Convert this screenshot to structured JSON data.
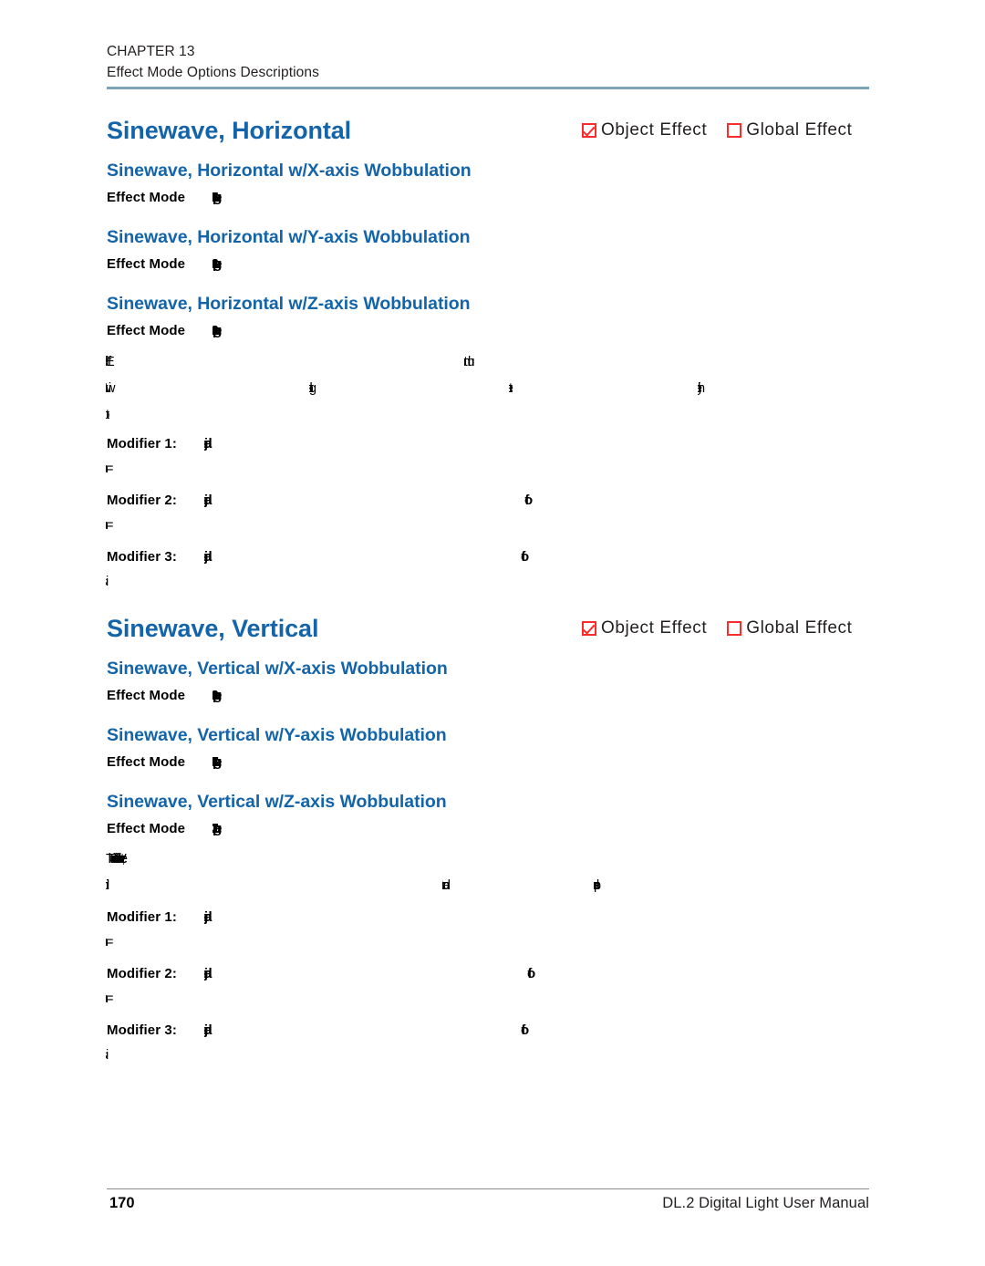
{
  "page": {
    "number": "170",
    "manual_title": "DL.2 Digital Light User Manual"
  },
  "header": {
    "chapter": "CHAPTER 13",
    "subtitle": "Effect Mode Options Descriptions",
    "rule_color": "#7ba4bb"
  },
  "scope_legend": {
    "object_effect_label": "Object  Effect",
    "global_effect_label": "Global  Effect",
    "checkbox_color": "#ff2a2a",
    "object_checked": true,
    "global_checked": false
  },
  "theme": {
    "heading_blue": "#1464aa",
    "text_black": "#231f20"
  },
  "sections": [
    {
      "title": "Sinewave, Horizontal",
      "scope": {
        "object_effect_label": "Object  Effect",
        "global_effect_label": "Global  Effect"
      },
      "subsections": [
        {
          "heading": "Sinewave, Horizontal w/X-axis Wobbulation",
          "field_label": "Effect Mode",
          "field_value": "page 165"
        },
        {
          "heading": "Sinewave, Horizontal w/Y-axis Wobbulation",
          "field_label": "Effect Mode",
          "field_value": "page 166"
        },
        {
          "heading": "Sinewave, Horizontal w/Z-axis Wobbulation",
          "field_label": "Effect Mode",
          "field_value": "page 169"
        }
      ],
      "body_lines": [
        {
          "col1": "Effect may",
          "col2": "",
          "col3": "multiply with",
          "col4": ""
        },
        {
          "col1": "with",
          "col2": "globally",
          "col3": "the limit",
          "col4": "higher"
        },
        {
          "col1": "to",
          "col2": "",
          "col3": "",
          "col4": ""
        }
      ],
      "modifiers": [
        {
          "label": "Modifier 1:",
          "value": "adjusts the amplitude of the sinewave, 0-100%",
          "value2": "",
          "continuation": "= none"
        },
        {
          "label": "Modifier 2:",
          "value": "adjusts the",
          "value2": "of the sinewave, 0-100%",
          "continuation": "= none"
        },
        {
          "label": "Modifier 3:",
          "value": "adjusts the",
          "value2": "of the sinewave, 0-100%",
          "continuation": "is 0"
        }
      ]
    },
    {
      "title": "Sinewave, Vertical",
      "scope": {
        "object_effect_label": "Object  Effect",
        "global_effect_label": "Global  Effect"
      },
      "subsections": [
        {
          "heading": "Sinewave, Vertical w/X-axis Wobbulation",
          "field_label": "Effect Mode",
          "field_value": "page 169"
        },
        {
          "heading": "Sinewave, Vertical w/Y-axis Wobbulation",
          "field_label": "Effect Mode",
          "field_value": "page 167"
        },
        {
          "heading": "Sinewave, Vertical w/Z-axis Wobbulation",
          "field_label": "Effect Mode",
          "field_value": "page 172"
        }
      ],
      "body_lines": [
        {
          "col1": "The Sinewave, Vertical effect",
          "col2": "",
          "col3": "",
          "col4": ""
        },
        {
          "col1": "individual",
          "col2": "and this",
          "col3": "produces",
          "col4": ""
        }
      ],
      "modifiers": [
        {
          "label": "Modifier 1:",
          "value": "adjusts the amplitude of the sinewave, 0-100%",
          "value2": "",
          "continuation": "= none"
        },
        {
          "label": "Modifier 2:",
          "value": "adjusts the",
          "value2": "of the sinewave, 0-100%",
          "continuation": "= none"
        },
        {
          "label": "Modifier 3:",
          "value": "adjusts the",
          "value2": "of the sinewave, 0-100%",
          "continuation": "is 0"
        }
      ]
    }
  ]
}
